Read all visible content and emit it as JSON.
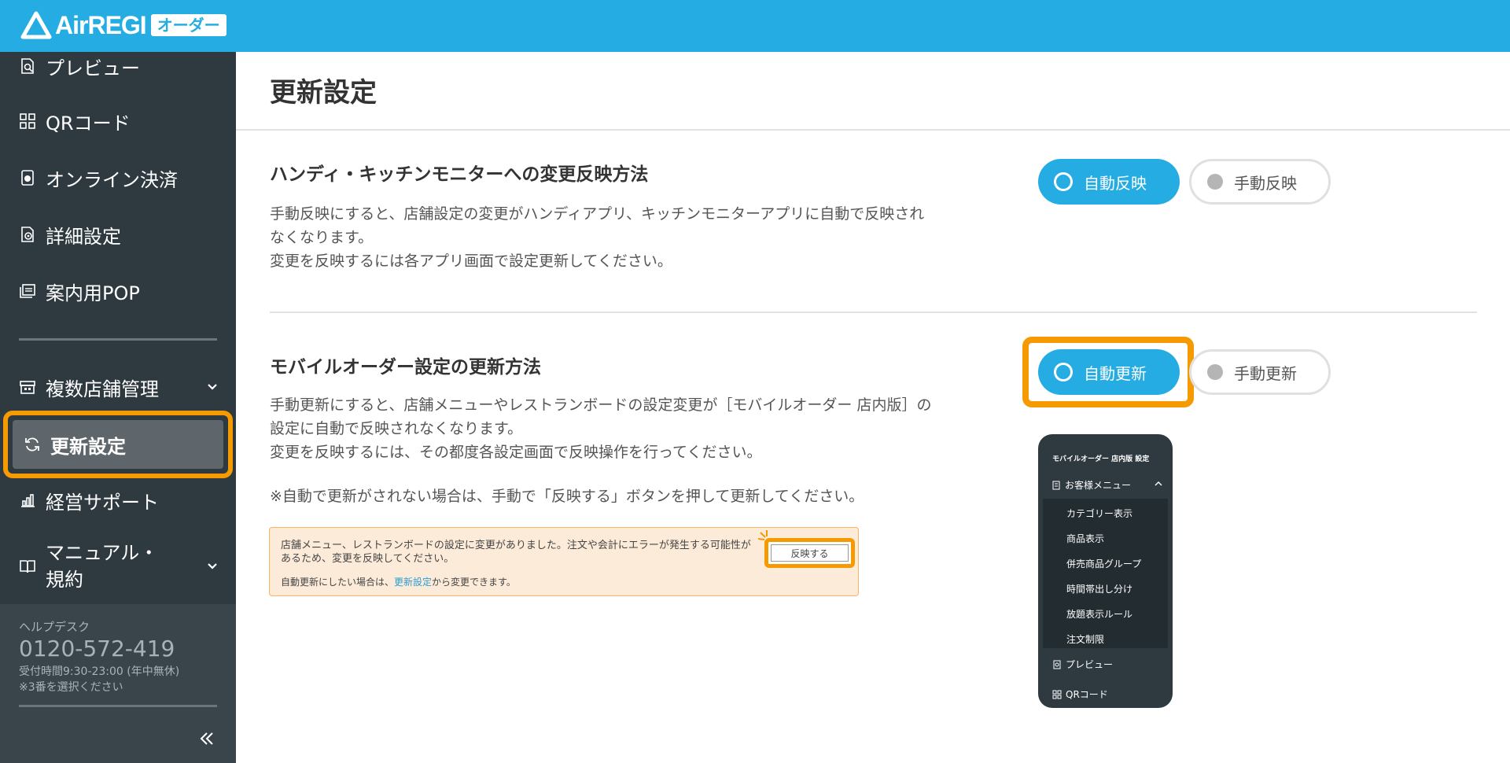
{
  "header": {
    "logo_text": "AirREGI",
    "logo_badge": "オーダー"
  },
  "sidebar": {
    "items": [
      {
        "label": "プレビュー",
        "icon": "preview-icon"
      },
      {
        "label": "QRコード",
        "icon": "qr-code-icon"
      },
      {
        "label": "オンライン決済",
        "icon": "online-payment-icon"
      },
      {
        "label": "詳細設定",
        "icon": "gear-icon"
      },
      {
        "label": "案内用POP",
        "icon": "pop-icon"
      },
      {
        "label": "複数店舗管理",
        "icon": "store-icon"
      },
      {
        "label": "更新設定",
        "icon": "refresh-icon",
        "active": true
      },
      {
        "label": "経営サポート",
        "icon": "chart-icon"
      },
      {
        "label": "マニュアル・規約",
        "icon": "book-icon"
      }
    ],
    "manual_line1": "マニュアル・",
    "manual_line2": "規約",
    "helpdesk": {
      "label": "ヘルプデスク",
      "phone": "0120-572-419",
      "hours": "受付時間9:30-23:00 (年中無休)",
      "note": "※3番を選択ください"
    }
  },
  "main": {
    "title": "更新設定",
    "section1": {
      "title": "ハンディ・キッチンモニターへの変更反映方法",
      "desc1": "手動反映にすると、店舗設定の変更がハンディアプリ、キッチンモニターアプリに自動で反映され",
      "desc2": "なくなります。",
      "desc3": "変更を反映するには各アプリ画面で設定更新してください。",
      "option_on": "自動反映",
      "option_off": "手動反映",
      "selected": "自動反映"
    },
    "section2": {
      "title": "モバイルオーダー設定の更新方法",
      "desc1": "手動更新にすると、店舗メニューやレストランボードの設定変更が［モバイルオーダー 店内版］の",
      "desc2": "設定に自動で反映されなくなります。",
      "desc3": "変更を反映するには、その都度各設定画面で反映操作を行ってください。",
      "note": "※自動で更新がされない場合は、手動で「反映する」ボタンを押して更新してください。",
      "option_on": "自動更新",
      "option_off": "手動更新",
      "selected": "自動更新"
    },
    "banner": {
      "text": "店舗メニュー、レストランボードの設定に変更がありました。注文や会計にエラーが発生する可能性があるため、変更を反映してください。",
      "sub_before": "自動更新にしたい場合は、",
      "sub_link": "更新設定",
      "sub_after": "から変更できます。",
      "button": "反映する"
    },
    "phone": {
      "title": "モバイルオーダー 店内版 設定",
      "menu": "お客様メニュー",
      "sub_items": [
        "カテゴリー表示",
        "商品表示",
        "併売商品グループ",
        "時間帯出し分け",
        "放題表示ルール",
        "注文制限"
      ],
      "bottom_items": [
        "プレビュー",
        "QRコード"
      ]
    }
  },
  "colors": {
    "brand": "#25ade3",
    "sidebar": "#2f3a40",
    "highlight": "#f59a00"
  }
}
